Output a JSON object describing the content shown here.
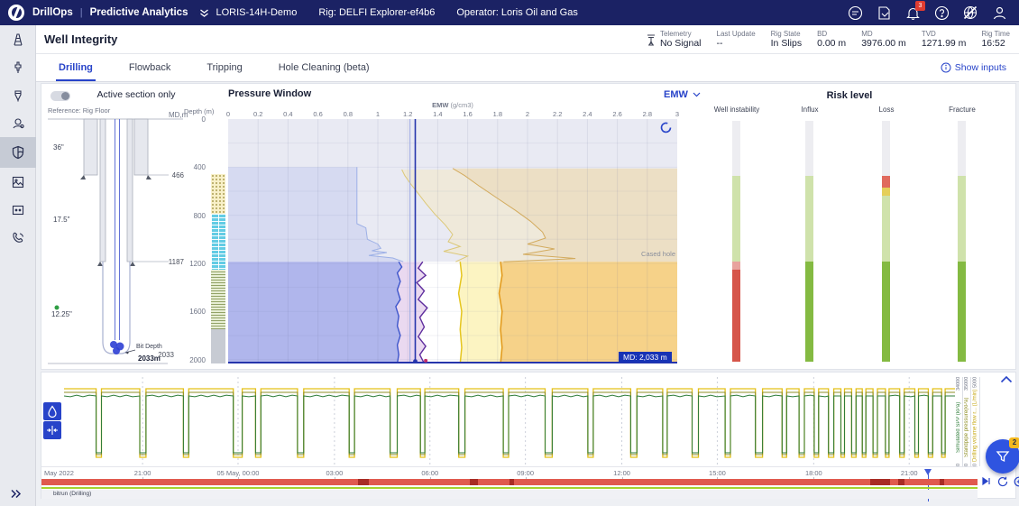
{
  "topbar": {
    "product": "DrillOps",
    "separator": "|",
    "app_name": "Predictive Analytics",
    "well_name": "LORIS-14H-Demo",
    "rig": "Rig: DELFI Explorer-ef4b6",
    "operator": "Operator: Loris Oil and Gas",
    "notification_badge": "3",
    "icons": [
      "message-icon",
      "report-icon",
      "bell-icon",
      "help-icon",
      "network-off-icon",
      "user-icon"
    ]
  },
  "sidebar": {
    "items": [
      "rig",
      "drillpipe",
      "drill-bit",
      "bha",
      "well-integrity",
      "image",
      "panel",
      "support"
    ],
    "active_index": 4
  },
  "header": {
    "title": "Well Integrity",
    "status_items": [
      {
        "label": "Telemetry",
        "value": "No Signal"
      },
      {
        "label": "Last Update",
        "value": "--"
      },
      {
        "label": "Rig State",
        "value": "In Slips"
      },
      {
        "label": "BD",
        "value": "0.00 m"
      },
      {
        "label": "MD",
        "value": "3976.00 m"
      },
      {
        "label": "TVD",
        "value": "1271.99 m"
      },
      {
        "label": "Rig Time",
        "value": "16:52"
      }
    ]
  },
  "tabs": {
    "items": [
      {
        "label": "Drilling",
        "active": true
      },
      {
        "label": "Flowback",
        "active": false
      },
      {
        "label": "Tripping",
        "active": false
      },
      {
        "label": "Hole Cleaning (beta)",
        "active": false
      }
    ],
    "show_inputs_label": "Show inputs"
  },
  "schematic": {
    "toggle_label": "Active section only",
    "reference_label": "Reference: Rig Floor",
    "md_axis_label": "MD,m",
    "sections": [
      {
        "size": "36\"",
        "shoe_md": "466"
      },
      {
        "size": "17.5\"",
        "shoe_md": "1187"
      },
      {
        "size": "12.25\"",
        "shoe_md": "2033"
      }
    ],
    "bit_depth_label": "Bit Depth",
    "bit_depth_value": "2033m",
    "lithology": [
      {
        "type": "sand",
        "d0": 460,
        "d1": 790
      },
      {
        "type": "lime",
        "d0": 790,
        "d1": 1250
      },
      {
        "type": "shale",
        "d0": 1250,
        "d1": 1750
      },
      {
        "type": "gray",
        "d0": 1750,
        "d1": 2033
      }
    ]
  },
  "pressure_chart": {
    "title": "Pressure Window",
    "unit_selector": "EMW",
    "axis_label_main": "EMW",
    "axis_label_unit": "(g/cm3)",
    "x_ticks": [
      "0",
      "0.2",
      "0.4",
      "0.6",
      "0.8",
      "1",
      "1.2",
      "1.4",
      "1.6",
      "1.8",
      "2",
      "2.2",
      "2.4",
      "2.6",
      "2.8",
      "3"
    ],
    "depth_axis_label": "Depth  (m)",
    "depth_ticks": [
      "0",
      "400",
      "800",
      "1200",
      "1600",
      "2000"
    ],
    "cased_hole_label": "Cased hole",
    "md_badge": "MD: 2,033 m",
    "current_emw": 1.25,
    "secondary_emw": 1.215,
    "cased_shoe_depth": 1187,
    "total_depth": 2033,
    "colors": {
      "cased_bg": "#e9eaf3"
    },
    "edges": {
      "fadedBlue": [
        [
          0.86,
          400
        ],
        [
          0.86,
          870
        ],
        [
          0.92,
          905
        ],
        [
          0.93,
          1000
        ],
        [
          1.0,
          1040
        ],
        [
          1.02,
          1075
        ],
        [
          0.96,
          1095
        ],
        [
          1.06,
          1110
        ],
        [
          0.94,
          1135
        ],
        [
          1.1,
          1155
        ],
        [
          1.17,
          1187
        ]
      ],
      "fadedYellow": [
        [
          1.16,
          420
        ],
        [
          1.18,
          470
        ],
        [
          1.22,
          540
        ],
        [
          1.27,
          620
        ],
        [
          1.32,
          700
        ],
        [
          1.38,
          790
        ],
        [
          1.45,
          880
        ],
        [
          1.5,
          960
        ],
        [
          1.47,
          1020
        ],
        [
          1.55,
          1060
        ],
        [
          1.44,
          1100
        ],
        [
          1.6,
          1140
        ],
        [
          1.52,
          1187
        ]
      ],
      "fadedOrange": [
        [
          1.5,
          410
        ],
        [
          1.58,
          470
        ],
        [
          1.68,
          560
        ],
        [
          1.8,
          660
        ],
        [
          1.92,
          760
        ],
        [
          2.02,
          850
        ],
        [
          2.1,
          940
        ],
        [
          2.12,
          990
        ],
        [
          2.0,
          1040
        ],
        [
          2.18,
          1080
        ],
        [
          1.97,
          1125
        ],
        [
          2.32,
          1160
        ],
        [
          1.84,
          1187
        ]
      ],
      "blueEdge": [
        [
          1.14,
          1187
        ],
        [
          1.16,
          1230
        ],
        [
          1.13,
          1280
        ],
        [
          1.15,
          1350
        ],
        [
          1.13,
          1420
        ],
        [
          1.15,
          1500
        ],
        [
          1.12,
          1560
        ],
        [
          1.14,
          1640
        ],
        [
          1.13,
          1720
        ],
        [
          1.15,
          1800
        ],
        [
          1.13,
          1880
        ],
        [
          1.14,
          1960
        ],
        [
          1.13,
          2033
        ]
      ],
      "purpleCurve": [
        [
          1.3,
          1187
        ],
        [
          1.27,
          1240
        ],
        [
          1.32,
          1300
        ],
        [
          1.26,
          1360
        ],
        [
          1.31,
          1430
        ],
        [
          1.27,
          1500
        ],
        [
          1.33,
          1570
        ],
        [
          1.28,
          1650
        ],
        [
          1.31,
          1730
        ],
        [
          1.27,
          1810
        ],
        [
          1.32,
          1890
        ],
        [
          1.28,
          1960
        ],
        [
          1.31,
          2033
        ]
      ],
      "yellowEdge": [
        [
          1.55,
          1187
        ],
        [
          1.56,
          1300
        ],
        [
          1.54,
          1450
        ],
        [
          1.56,
          1600
        ],
        [
          1.55,
          1750
        ],
        [
          1.56,
          1900
        ],
        [
          1.55,
          2033
        ]
      ],
      "orangeEdge": [
        [
          1.82,
          1187
        ],
        [
          1.83,
          1300
        ],
        [
          1.81,
          1450
        ],
        [
          1.83,
          1600
        ],
        [
          1.82,
          1750
        ],
        [
          1.83,
          1900
        ],
        [
          1.82,
          2033
        ]
      ]
    },
    "regions": [
      {
        "name": "cased-collapse",
        "edge": "fadedBlue",
        "close": "left",
        "fill": "#d6daf1"
      },
      {
        "name": "cased-tan",
        "edge": "fadedYellow",
        "close": "right",
        "fill": "#efe9da"
      },
      {
        "name": "cased-fracture",
        "edge": "fadedOrange",
        "close": "right",
        "fill": "#ecdfc5"
      },
      {
        "name": "open-collapse",
        "edge": "blueEdge",
        "close": "left",
        "fill": "#b0b6ec"
      },
      {
        "name": "pore-band",
        "edge": "blueEdge",
        "edge2": "purpleCurve",
        "fill": "#ead9f0"
      },
      {
        "name": "mud-window-band",
        "edge": "yellowEdge",
        "edge2": "orangeEdge",
        "fill": "#fcf4c2"
      },
      {
        "name": "open-fracture",
        "edge": "orangeEdge",
        "close": "right",
        "fill": "#f6d289"
      }
    ],
    "curves": [
      {
        "edge": "fadedBlue",
        "color": "#9db0e6",
        "width": 1
      },
      {
        "edge": "fadedYellow",
        "color": "#dcc878",
        "width": 1
      },
      {
        "edge": "fadedOrange",
        "color": "#d3ab5e",
        "width": 1
      },
      {
        "edge": "blueEdge",
        "color": "#3c55cb",
        "width": 1.4
      },
      {
        "edge": "purpleCurve",
        "color": "#5f2e9e",
        "width": 1.4
      },
      {
        "edge": "yellowEdge",
        "color": "#e5c51e",
        "width": 1.5
      },
      {
        "edge": "orangeEdge",
        "color": "#e2991b",
        "width": 1.5
      }
    ],
    "markers": [
      {
        "emw": 1.25,
        "depth": 2015,
        "color": "#2635ac",
        "r": 2.4
      },
      {
        "emw": 1.32,
        "depth": 2010,
        "color": "#c2306a",
        "r": 2
      }
    ]
  },
  "risk_panel": {
    "title": "Risk level",
    "bars": [
      {
        "label": "Well instability",
        "segments": [
          {
            "d0": 0,
            "d1": 466,
            "color": "#ededf1"
          },
          {
            "d0": 466,
            "d1": 1187,
            "color": "#cfe2ab"
          },
          {
            "d0": 1187,
            "d1": 1255,
            "color": "#e8a39e"
          },
          {
            "d0": 1255,
            "d1": 2033,
            "color": "#d6554a"
          }
        ]
      },
      {
        "label": "Influx",
        "segments": [
          {
            "d0": 0,
            "d1": 466,
            "color": "#ededf1"
          },
          {
            "d0": 466,
            "d1": 1187,
            "color": "#cfe2ab"
          },
          {
            "d0": 1187,
            "d1": 2033,
            "color": "#84ba42"
          }
        ]
      },
      {
        "label": "Loss",
        "segments": [
          {
            "d0": 0,
            "d1": 466,
            "color": "#ededf1"
          },
          {
            "d0": 466,
            "d1": 565,
            "color": "#e06a5e"
          },
          {
            "d0": 565,
            "d1": 635,
            "color": "#e5cf5a"
          },
          {
            "d0": 635,
            "d1": 1187,
            "color": "#cfe2ab"
          },
          {
            "d0": 1187,
            "d1": 2033,
            "color": "#84ba42"
          }
        ]
      },
      {
        "label": "Fracture",
        "segments": [
          {
            "d0": 0,
            "d1": 466,
            "color": "#ededf1"
          },
          {
            "d0": 466,
            "d1": 1187,
            "color": "#cfe2ab"
          },
          {
            "d0": 1187,
            "d1": 2033,
            "color": "#84ba42"
          }
        ]
      }
    ]
  },
  "strip_chart": {
    "series": [
      {
        "label": "Simulated SPP (kPa)",
        "max": "34000",
        "min": "0",
        "color": "#2f7d3a"
      },
      {
        "label": "Standpipe pressure(kPa)",
        "max": "35000",
        "min": "0",
        "color": "#8f8f25"
      },
      {
        "label": "Drilling volume flow r... (L/min)",
        "max": "5000",
        "min": "0",
        "color": "#c7a916"
      }
    ],
    "dips": [
      [
        0.036,
        0.006
      ],
      [
        0.085,
        0.007
      ],
      [
        0.134,
        0.006
      ],
      [
        0.19,
        0.01
      ],
      [
        0.215,
        0.006
      ],
      [
        0.262,
        0.007
      ],
      [
        0.32,
        0.006
      ],
      [
        0.366,
        0.008
      ],
      [
        0.4,
        0.005
      ],
      [
        0.443,
        0.007
      ],
      [
        0.493,
        0.006
      ],
      [
        0.54,
        0.008
      ],
      [
        0.588,
        0.006
      ],
      [
        0.636,
        0.007
      ],
      [
        0.672,
        0.005
      ],
      [
        0.705,
        0.007
      ],
      [
        0.742,
        0.006
      ],
      [
        0.776,
        0.008
      ],
      [
        0.806,
        0.005
      ],
      [
        0.825,
        0.006
      ],
      [
        0.842,
        0.005
      ],
      [
        0.858,
        0.006
      ],
      [
        0.872,
        0.004
      ],
      [
        0.884,
        0.005
      ],
      [
        0.896,
        0.004
      ],
      [
        0.908,
        0.005
      ],
      [
        0.922,
        0.004
      ],
      [
        0.938,
        0.005
      ],
      [
        0.955,
        0.004
      ],
      [
        0.97,
        0.005
      ],
      [
        0.985,
        0.004
      ]
    ]
  },
  "timeline": {
    "month_label": "May 2022",
    "ticks": [
      {
        "label": "21:00",
        "f": 0.108
      },
      {
        "label": "05 May, 00:00",
        "f": 0.21
      },
      {
        "label": "03:00",
        "f": 0.313
      },
      {
        "label": "06:00",
        "f": 0.415
      },
      {
        "label": "09:00",
        "f": 0.517
      },
      {
        "label": "12:00",
        "f": 0.62
      },
      {
        "label": "15:00",
        "f": 0.722
      },
      {
        "label": "18:00",
        "f": 0.825
      },
      {
        "label": "21:00",
        "f": 0.927
      }
    ],
    "cursor_f": 0.947,
    "activity_label": "bitrun (Drilling)",
    "activity_segments": [
      [
        0.338,
        0.012
      ],
      [
        0.458,
        0.008
      ],
      [
        0.5,
        0.005
      ],
      [
        0.885,
        0.022
      ],
      [
        0.915,
        0.007
      ],
      [
        0.96,
        0.004
      ]
    ],
    "fab_badge": "2"
  }
}
